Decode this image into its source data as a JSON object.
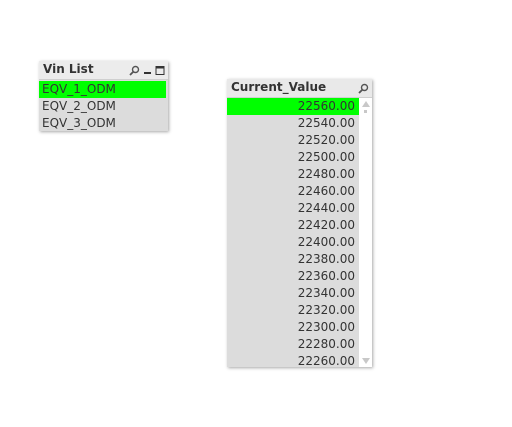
{
  "colors": {
    "selected": "#00ff00",
    "listbox_bg": "#dcdcdc",
    "header_bg": "#ececec",
    "text": "#333333"
  },
  "vin_list": {
    "title": "Vin List",
    "icons": [
      "search-icon",
      "minimize-icon",
      "maximize-icon"
    ],
    "items": [
      {
        "label": "EQV_1_ODM",
        "selected": true
      },
      {
        "label": "EQV_2_ODM",
        "selected": false
      },
      {
        "label": "EQV_3_ODM",
        "selected": false
      }
    ]
  },
  "current_value": {
    "title": "Current_Value",
    "icons": [
      "search-icon"
    ],
    "items": [
      {
        "label": "22560.00",
        "selected": true
      },
      {
        "label": "22540.00",
        "selected": false
      },
      {
        "label": "22520.00",
        "selected": false
      },
      {
        "label": "22500.00",
        "selected": false
      },
      {
        "label": "22480.00",
        "selected": false
      },
      {
        "label": "22460.00",
        "selected": false
      },
      {
        "label": "22440.00",
        "selected": false
      },
      {
        "label": "22420.00",
        "selected": false
      },
      {
        "label": "22400.00",
        "selected": false
      },
      {
        "label": "22380.00",
        "selected": false
      },
      {
        "label": "22360.00",
        "selected": false
      },
      {
        "label": "22340.00",
        "selected": false
      },
      {
        "label": "22320.00",
        "selected": false
      },
      {
        "label": "22300.00",
        "selected": false
      },
      {
        "label": "22280.00",
        "selected": false
      },
      {
        "label": "22260.00",
        "selected": false
      }
    ]
  }
}
